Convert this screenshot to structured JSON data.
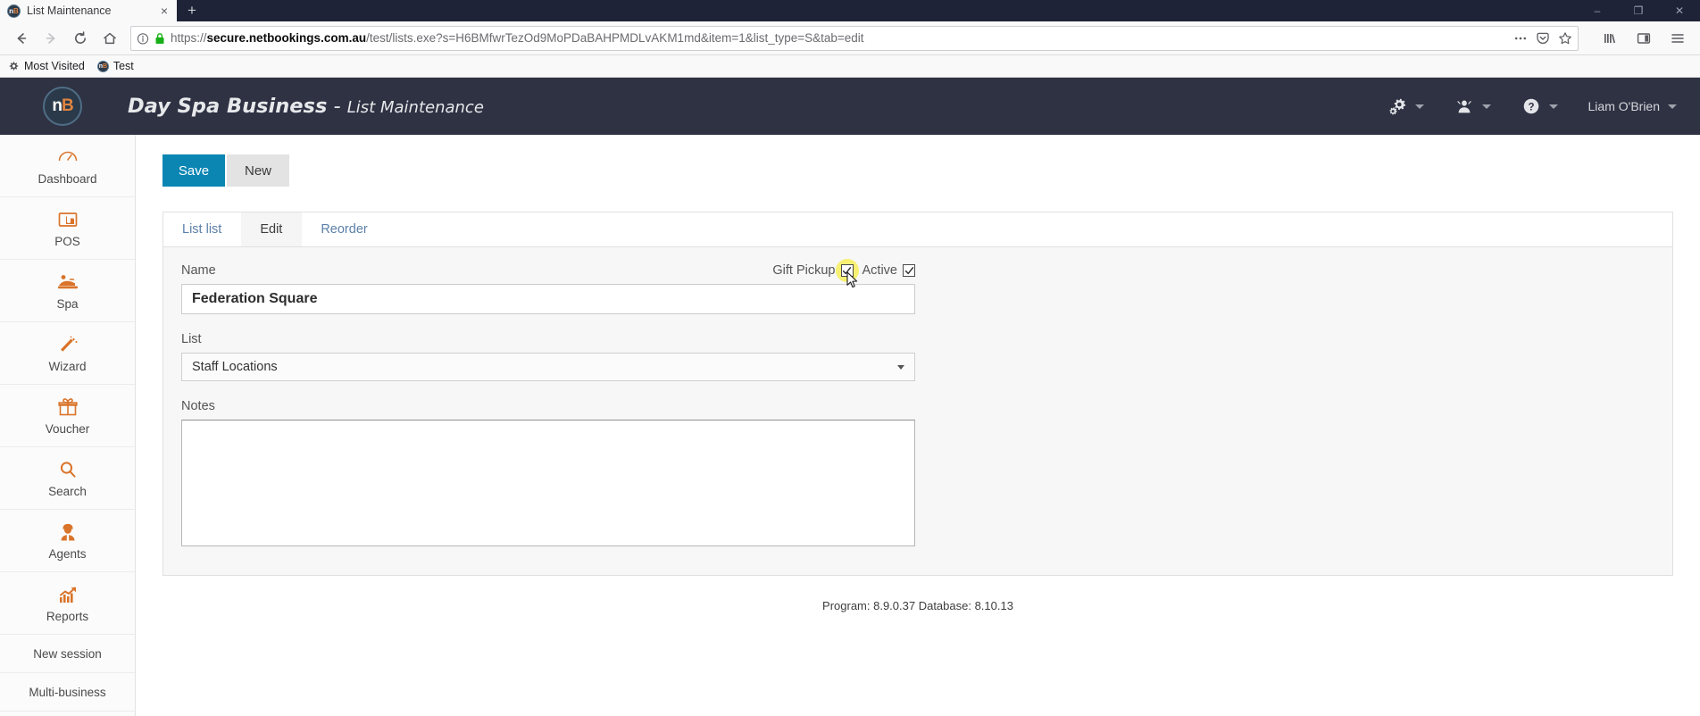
{
  "browser": {
    "tab": {
      "title": "List Maintenance",
      "favicon": "nb-favicon-icon",
      "close": "×"
    },
    "new_tab_label": "+",
    "window_controls": {
      "minimize": "–",
      "restore": "❐",
      "close": "✕"
    },
    "url": {
      "full": "https://secure.netbookings.com.au/test/lists.exe?s=H6BMfwrTezOd9MoPDaBAHPMDLvAKM1md&item=1&list_type=S&tab=edit",
      "scheme": "https://",
      "host": "secure.netbookings.com.au",
      "path": "/test/lists.exe?s=H6BMfwrTezOd9MoPDaBAHPMDLvAKM1md&item=1&list_type=S&tab=edit"
    },
    "bookmarks": [
      {
        "label": "Most Visited",
        "icon": "star-burst-icon"
      },
      {
        "label": "Test",
        "icon": "nb-favicon-icon"
      }
    ]
  },
  "app": {
    "logo": {
      "n": "n",
      "b": "B"
    },
    "business": "Day Spa Business",
    "separator": " - ",
    "section": "List Maintenance",
    "header_menu": [
      {
        "name": "settings",
        "icon": "gears-icon",
        "label": ""
      },
      {
        "name": "user-switch",
        "icon": "person-icon",
        "label": ""
      },
      {
        "name": "help",
        "icon": "question-circle-icon",
        "label": ""
      },
      {
        "name": "account",
        "icon": "",
        "label": "Liam O'Brien"
      }
    ]
  },
  "sidebar": {
    "items": [
      {
        "label": "Dashboard",
        "icon": "gauge-icon"
      },
      {
        "label": "POS",
        "icon": "pos-terminal-icon"
      },
      {
        "label": "Spa",
        "icon": "spa-massage-icon"
      },
      {
        "label": "Wizard",
        "icon": "magic-wand-icon"
      },
      {
        "label": "Voucher",
        "icon": "gift-icon"
      },
      {
        "label": "Search",
        "icon": "magnifier-icon"
      },
      {
        "label": "Agents",
        "icon": "agent-person-icon"
      },
      {
        "label": "Reports",
        "icon": "chart-arrow-icon"
      }
    ],
    "plain_items": [
      {
        "label": "New session"
      },
      {
        "label": "Multi-business"
      }
    ]
  },
  "toolbar": {
    "save_label": "Save",
    "new_label": "New"
  },
  "tabs": [
    {
      "label": "List list",
      "active": false
    },
    {
      "label": "Edit",
      "active": true
    },
    {
      "label": "Reorder",
      "active": false
    }
  ],
  "form": {
    "name": {
      "label": "Name",
      "value": "Federation Square",
      "placeholder": ""
    },
    "gift_pickup": {
      "label": "Gift Pickup",
      "checked": true,
      "highlighted": true
    },
    "active": {
      "label": "Active",
      "checked": true,
      "highlighted": false
    },
    "list": {
      "label": "List",
      "value": "Staff Locations",
      "options": [
        "Staff Locations"
      ]
    },
    "notes": {
      "label": "Notes",
      "value": "",
      "placeholder": ""
    }
  },
  "footer": {
    "text": "Program: 8.9.0.37 Database: 8.10.13"
  },
  "colors": {
    "header_bg": "#2e3243",
    "accent_blue": "#0b86b3",
    "accent_orange": "#d9742a",
    "highlight_yellow": "#f7ef5a"
  }
}
